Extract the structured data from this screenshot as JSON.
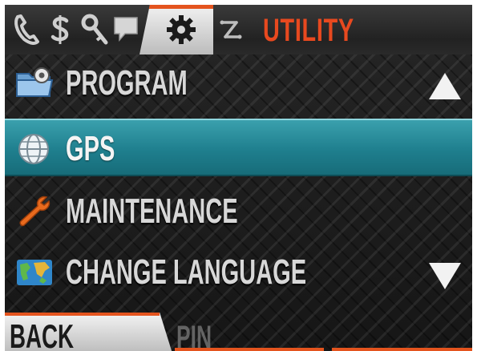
{
  "header": {
    "title": "UTILITY",
    "tabs": [
      {
        "icon": "phone-icon",
        "active": false
      },
      {
        "icon": "dollar-icon",
        "active": false
      },
      {
        "icon": "key-icon",
        "active": false
      },
      {
        "icon": "message-icon",
        "active": false
      },
      {
        "icon": "gear-icon",
        "active": true
      },
      {
        "icon": "shuffle-icon",
        "active": false
      }
    ]
  },
  "menu": {
    "items": [
      {
        "label": "PROGRAM",
        "icon": "folder-gear-icon",
        "selected": false
      },
      {
        "label": "GPS",
        "icon": "globe-icon",
        "selected": true
      },
      {
        "label": "MAINTENANCE",
        "icon": "wrench-icon",
        "selected": false
      },
      {
        "label": "CHANGE LANGUAGE",
        "icon": "world-map-icon",
        "selected": false
      }
    ],
    "scroll_up_icon": "up-arrow-icon",
    "scroll_down_icon": "down-arrow-icon"
  },
  "softkeys": {
    "left_label": "BACK",
    "middle_label": "PIN"
  },
  "colors": {
    "accent": "#e8491f",
    "selection": "#1f7f8e",
    "text": "#d8d8d8"
  }
}
